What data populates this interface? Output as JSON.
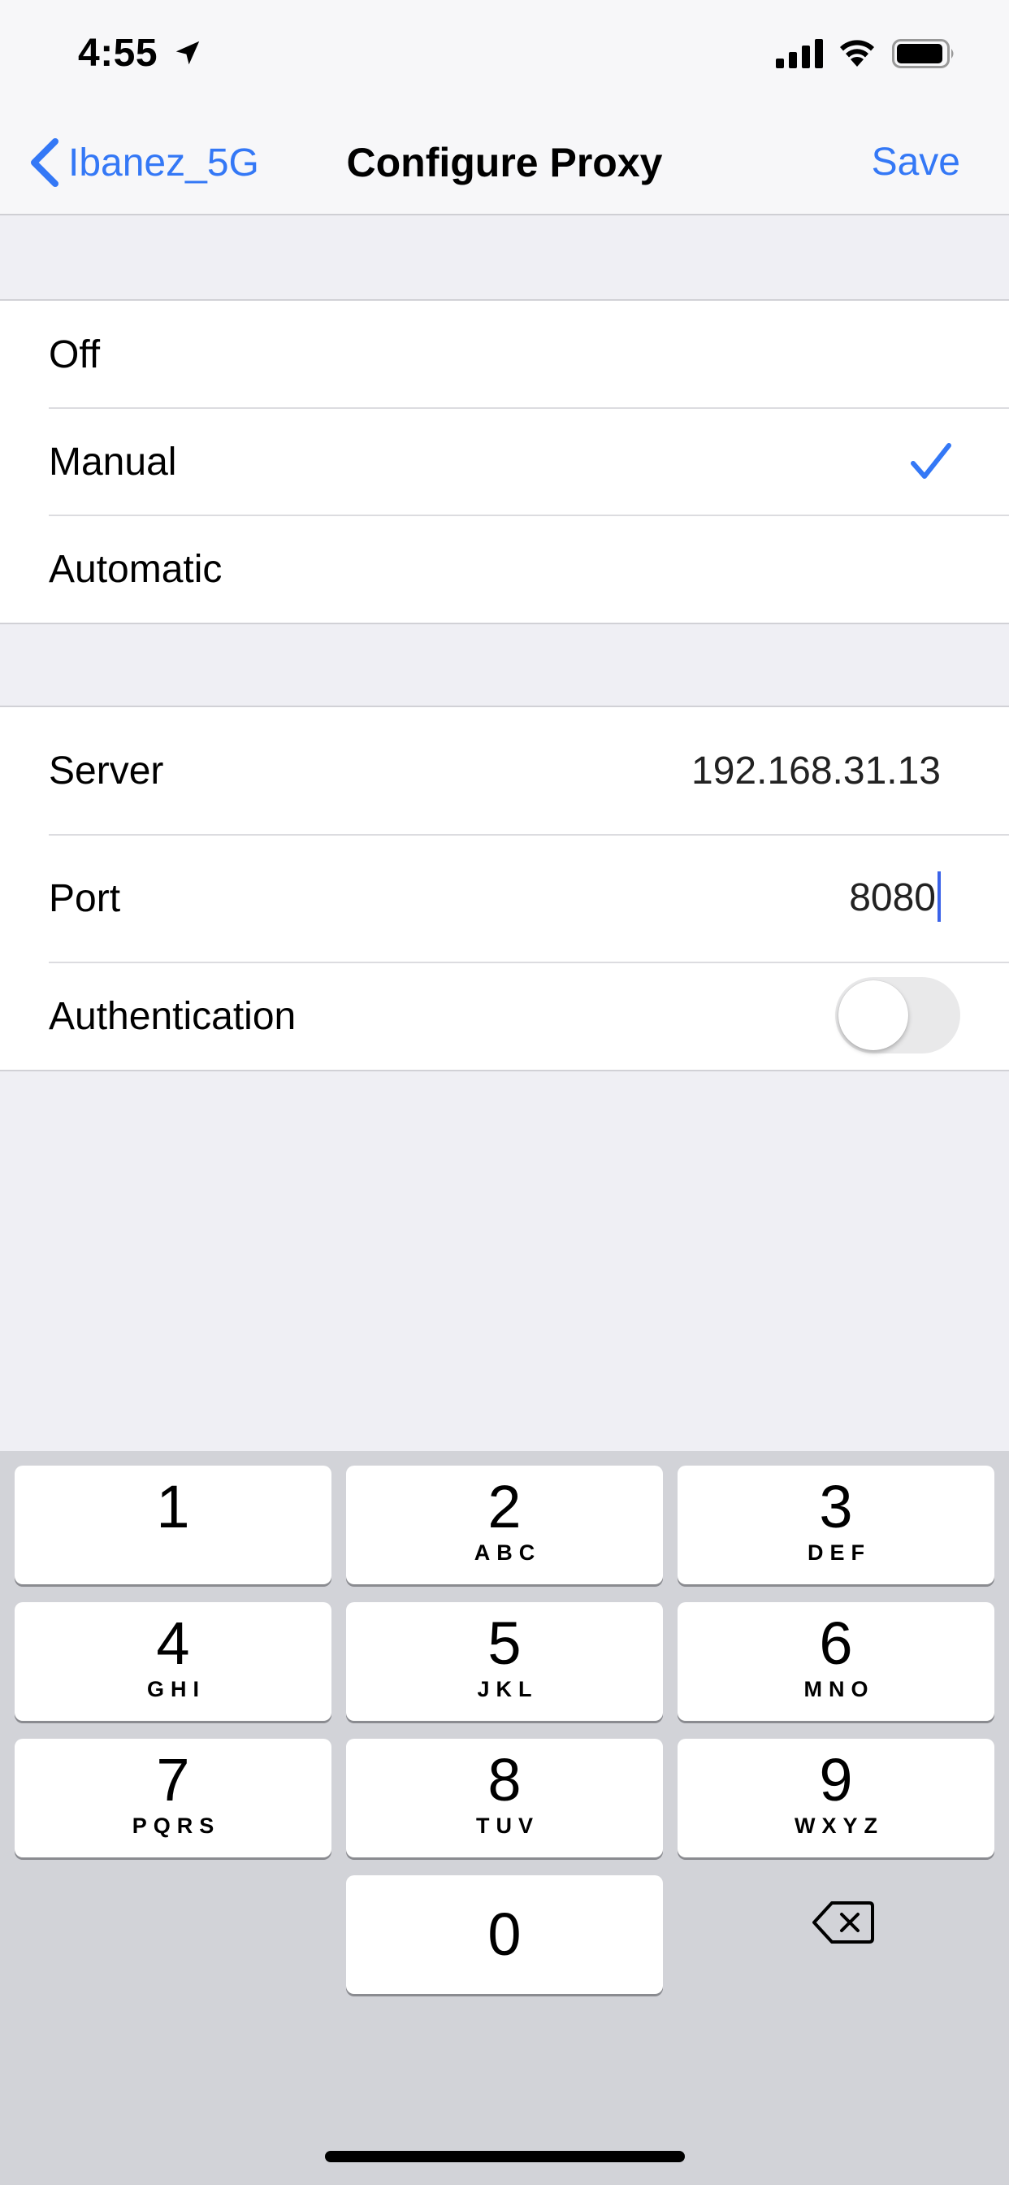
{
  "status_bar": {
    "time": "4:55",
    "icons": [
      "location-arrow-icon",
      "cellular-signal-icon",
      "wifi-icon",
      "battery-icon"
    ]
  },
  "nav": {
    "back_label": "Ibanez_5G",
    "title": "Configure Proxy",
    "save_label": "Save"
  },
  "proxy_mode": {
    "options": [
      {
        "label": "Off",
        "selected": false
      },
      {
        "label": "Manual",
        "selected": true
      },
      {
        "label": "Automatic",
        "selected": false
      }
    ]
  },
  "manual": {
    "server_label": "Server",
    "server_value": "192.168.31.13",
    "port_label": "Port",
    "port_value": "8080",
    "auth_label": "Authentication",
    "auth_enabled": false
  },
  "keypad": {
    "keys": [
      {
        "digit": "1",
        "letters": ""
      },
      {
        "digit": "2",
        "letters": "ABC"
      },
      {
        "digit": "3",
        "letters": "DEF"
      },
      {
        "digit": "4",
        "letters": "GHI"
      },
      {
        "digit": "5",
        "letters": "JKL"
      },
      {
        "digit": "6",
        "letters": "MNO"
      },
      {
        "digit": "7",
        "letters": "PQRS"
      },
      {
        "digit": "8",
        "letters": "TUV"
      },
      {
        "digit": "9",
        "letters": "WXYZ"
      },
      {
        "digit": "0",
        "letters": ""
      }
    ]
  },
  "colors": {
    "accent": "#3478f6",
    "caret": "#3a63e9",
    "grouped_background": "#efeff4",
    "keyboard_background": "#d2d3d8"
  }
}
